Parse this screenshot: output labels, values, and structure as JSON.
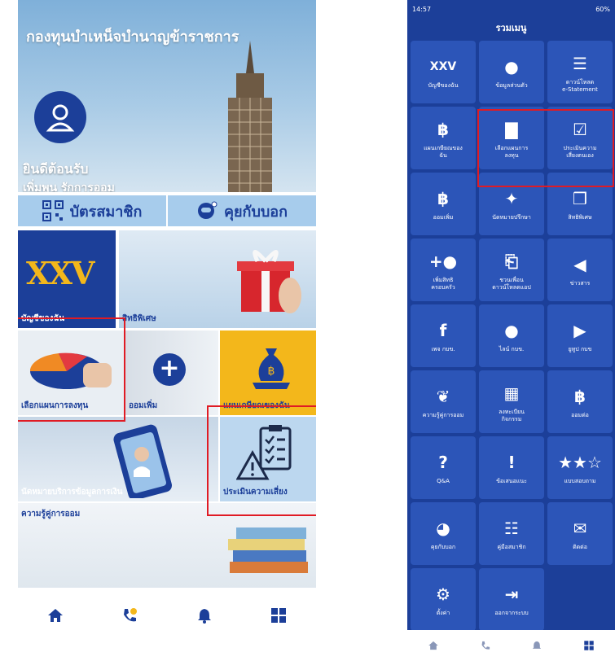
{
  "left": {
    "hero": {
      "title": "กองทุนบำเหน็จบำนาญข้าราชการ",
      "welcome": "ยินดีต้อนรับ",
      "slogan": "เพิ่มพูน รักการออม"
    },
    "buttons": {
      "member_card": "บัตรสมาชิก",
      "chat": "คุยกับบอก"
    },
    "tiles": {
      "account": {
        "logo": "XXV",
        "label": "บัญชีของฉัน"
      },
      "privilege": {
        "label": "สิทธิพิเศษ"
      },
      "investment_plan": {
        "label": "เลือกแผนการลงทุน"
      },
      "extra_saving": {
        "label": "ออมเพิ่ม"
      },
      "retirement_plan": {
        "label": "แผนเกษียณของฉัน"
      },
      "financial_advice": {
        "label": "นัดหมายบริการข้อมูลการเงิน"
      },
      "risk_assessment": {
        "label": "ประเมินความเสี่ยง"
      },
      "saving_knowledge": {
        "label": "ความรู้คู่การออม"
      }
    },
    "nav": [
      "home-icon",
      "phone-icon",
      "bell-icon",
      "grid-icon"
    ]
  },
  "right": {
    "status": {
      "time": "14:57",
      "right": "60%"
    },
    "title": "รวมเมนู",
    "items": [
      {
        "icon": "xxv-logo-icon",
        "label": "บัญชีของฉัน"
      },
      {
        "icon": "person-icon",
        "label": "ข้อมูลส่วนตัว"
      },
      {
        "icon": "document-icon",
        "label": "ดาวน์โหลด\ne-Statement"
      },
      {
        "icon": "money-hand-icon",
        "label": "แผนเกษียณของ\nฉัน"
      },
      {
        "icon": "bank-chart-icon",
        "label": "เลือกแผนการ\nลงทุน"
      },
      {
        "icon": "checklist-icon",
        "label": "ประเมินความ\nเสี่ยงตนเอง"
      },
      {
        "icon": "coin-hand-icon",
        "label": "ออมเพิ่ม"
      },
      {
        "icon": "handshake-icon",
        "label": "นัดหมายปรึกษา"
      },
      {
        "icon": "gift-icon",
        "label": "สิทธิพิเศษ"
      },
      {
        "icon": "add-family-icon",
        "label": "เพิ่มสิทธิ\nครอบครัว"
      },
      {
        "icon": "share-app-icon",
        "label": "ชวนเพื่อน\nดาวน์โหลดแอป"
      },
      {
        "icon": "megaphone-icon",
        "label": "ข่าวสาร"
      },
      {
        "icon": "facebook-icon",
        "label": "เพจ กบข."
      },
      {
        "icon": "line-icon",
        "label": "ไลน์ กบข."
      },
      {
        "icon": "youtube-icon",
        "label": "ยูทูป กบข"
      },
      {
        "icon": "sprout-icon",
        "label": "ความรู้คู่การออม"
      },
      {
        "icon": "calendar-icon",
        "label": "ลงทะเบียน\nกิจกรรม"
      },
      {
        "icon": "money-bag-icon",
        "label": "ออมต่อ"
      },
      {
        "icon": "question-icon",
        "label": "Q&A"
      },
      {
        "icon": "alert-message-icon",
        "label": "ข้อเสนอแนะ"
      },
      {
        "icon": "star-rating-icon",
        "label": "แบบสอบถาม"
      },
      {
        "icon": "robot-icon",
        "label": "คุยกับบอก"
      },
      {
        "icon": "book-icon",
        "label": "คู่มือสมาชิก"
      },
      {
        "icon": "mail-icon",
        "label": "ติดต่อ"
      },
      {
        "icon": "gear-icon",
        "label": "ตั้งค่า"
      },
      {
        "icon": "logout-icon",
        "label": "ออกจากระบบ"
      }
    ]
  }
}
